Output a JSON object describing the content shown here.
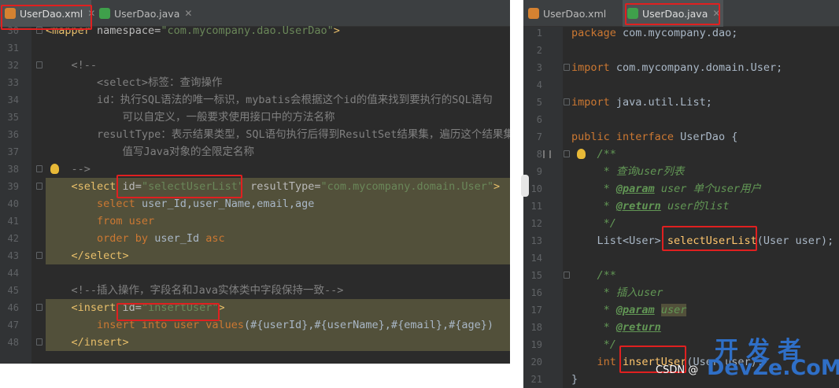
{
  "left_editor": {
    "tabs": [
      {
        "label": "UserDao.xml",
        "active": true,
        "icon": "xml-file-icon"
      },
      {
        "label": "UserDao.java",
        "active": false,
        "icon": "java-interface-icon"
      }
    ],
    "line_numbers": [
      "30",
      "31",
      "32",
      "33",
      "34",
      "35",
      "36",
      "37",
      "38",
      "39",
      "40",
      "41",
      "42",
      "43",
      "44",
      "45",
      "46",
      "47",
      "48"
    ],
    "lines": [
      "<mapper namespace=\"com.mycompany.dao.UserDao\">",
      "",
      "    <!--",
      "        <select>标签：查询操作",
      "        id：执行SQL语法的唯一标识，mybatis会根据这个id的值来找到要执行的SQL语句",
      "            可以自定义，一般要求使用接口中的方法名称",
      "        resultType：表示结果类型，SQL语句执行后得到ResultSet结果集，遍历这个结果集得",
      "            值写Java对象的全限定名称",
      "    -->",
      "    <select id=\"selectUserList\" resultType=\"com.mycompany.domain.User\">",
      "        select user_Id,user_Name,email,age",
      "        from user",
      "        order by user_Id asc",
      "    </select>",
      "",
      "    <!--插入操作，字段名和Java实体类中字段保持一致-->",
      "    <insert id=\"insertUser\">",
      "        insert into user values(#{userId},#{userName},#{email},#{age})",
      "    </insert>"
    ]
  },
  "right_editor": {
    "tabs": [
      {
        "label": "UserDao.xml",
        "active": false,
        "icon": "xml-file-icon"
      },
      {
        "label": "UserDao.java",
        "active": true,
        "icon": "java-interface-icon"
      }
    ],
    "line_numbers": [
      "1",
      "2",
      "3",
      "4",
      "5",
      "6",
      "7",
      "8",
      "9",
      "10",
      "11",
      "12",
      "13",
      "14",
      "15",
      "16",
      "17",
      "18",
      "19",
      "20",
      "21"
    ],
    "lines": [
      "package com.mycompany.dao;",
      "",
      "import com.mycompany.domain.User;",
      "",
      "import java.util.List;",
      "",
      "public interface UserDao {",
      "    /**",
      "     * 查询user列表",
      "     * @param user 单个user用户",
      "     * @return user的list",
      "     */",
      "    List<User> selectUserList(User user);",
      "",
      "    /**",
      "     * 插入user",
      "     * @param user",
      "     * @return",
      "     */",
      "    int insertUser(User user);",
      "}"
    ]
  },
  "watermarks": {
    "csdn": "CSDN @",
    "devze_cn": "开发者",
    "devze_en": "DevZe.CoM"
  }
}
